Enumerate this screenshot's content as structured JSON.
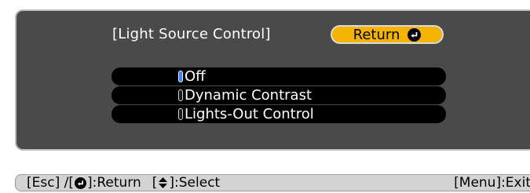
{
  "menu": {
    "title": "[Light Source Control]",
    "return_label": "Return",
    "return_icon": "enter-icon",
    "accent_color": "#f4b400",
    "selected_color": "#3b82ff",
    "options": [
      {
        "label": "Off",
        "selected": true
      },
      {
        "label": "Dynamic Contrast",
        "selected": false
      },
      {
        "label": "Lights-Out Control",
        "selected": false
      }
    ]
  },
  "status_bar": {
    "esc_label": "[Esc] /[",
    "return_label": "]:Return",
    "select_open": "[",
    "select_label": "]:Select",
    "exit_label": "[Menu]:Exit",
    "enter_icon": "enter-icon",
    "select_icon": "up-down-arrows-icon"
  }
}
